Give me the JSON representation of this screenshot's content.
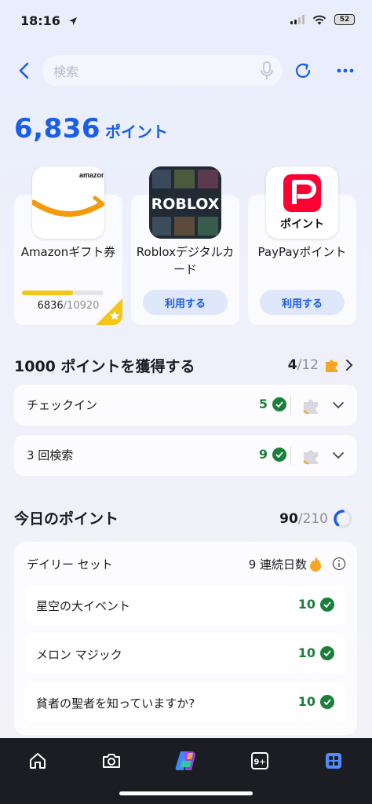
{
  "status": {
    "time": "18:16",
    "battery": "52"
  },
  "header": {
    "search_placeholder": "検索"
  },
  "points": {
    "value": "6,836",
    "unit": "ポイント"
  },
  "rewards": [
    {
      "label": "Amazonギフト券",
      "progress_current": "6836",
      "progress_total": "/10920",
      "progress_fraction": 0.626,
      "logo_text": "amazon"
    },
    {
      "label": "Robloxデジタルカード",
      "button": "利用する",
      "logo_text": "ROBLOX"
    },
    {
      "label": "PayPayポイント",
      "button": "利用する",
      "logo_text": "ポイント"
    }
  ],
  "earn_section": {
    "title": "1000 ポイントを獲得する",
    "progress_done": "4",
    "progress_total": "/12",
    "tasks": [
      {
        "label": "チェックイン",
        "count": "5"
      },
      {
        "label": "3 回検索",
        "count": "9"
      }
    ]
  },
  "today_section": {
    "title": "今日のポイント",
    "current": "90",
    "total": "/210",
    "daily_set": {
      "title": "デイリー セット",
      "streak": "9 連続日数",
      "items": [
        {
          "label": "星空の大イベント",
          "value": "10"
        },
        {
          "label": "メロン マジック",
          "value": "10"
        },
        {
          "label": "貧者の聖者を知っていますか?",
          "value": "10"
        }
      ]
    }
  },
  "colors": {
    "accent": "#1a5de6",
    "success": "#1b7f3b",
    "nav_bg": "#1c1d22"
  }
}
